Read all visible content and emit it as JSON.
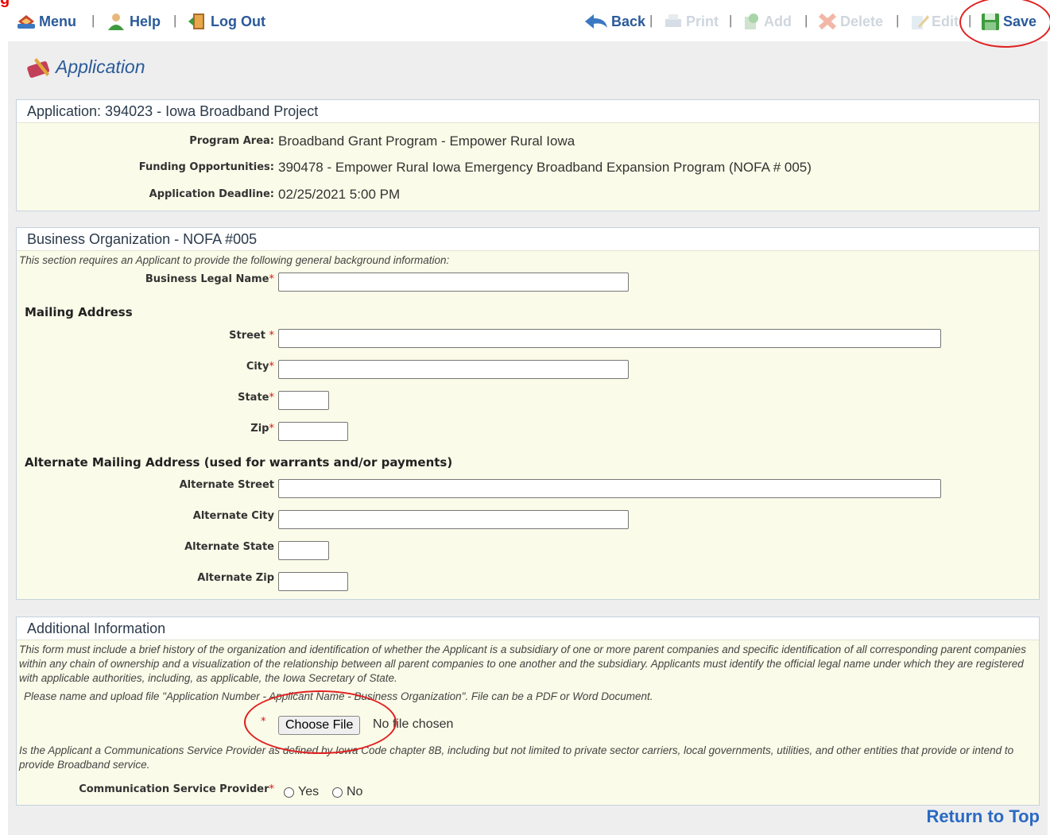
{
  "banner_text": "g",
  "toolbar": {
    "menu": "Menu",
    "help": "Help",
    "logout": "Log Out",
    "back": "Back",
    "print": "Print",
    "add": "Add",
    "delete": "Delete",
    "edit": "Edit",
    "save": "Save",
    "separator": "|"
  },
  "page": {
    "title": "Application"
  },
  "app_panel": {
    "header": "Application: 394023 - Iowa Broadband Project",
    "fields": [
      {
        "label": "Program Area:",
        "value": "Broadband Grant Program - Empower Rural Iowa"
      },
      {
        "label": "Funding Opportunities:",
        "value": "390478 - Empower Rural Iowa Emergency Broadband Expansion Program (NOFA # 005)"
      },
      {
        "label": "Application Deadline:",
        "value": "02/25/2021 5:00 PM"
      }
    ]
  },
  "business_panel": {
    "header": "Business Organization - NOFA #005",
    "intro": "This section requires an Applicant to provide the following general background information:",
    "legal_name_label": "Business Legal Name",
    "mailing_heading": "Mailing Address",
    "street_label": "Street ",
    "city_label": "City",
    "state_label": "State",
    "zip_label": "Zip",
    "alt_heading": "Alternate Mailing Address (used for warrants and/or payments)",
    "alt_street_label": "Alternate Street",
    "alt_city_label": "Alternate City",
    "alt_state_label": "Alternate State",
    "alt_zip_label": "Alternate Zip",
    "required_mark": "*"
  },
  "additional_panel": {
    "header": "Additional Information",
    "description": "This form must include a brief history of the organization and identification of whether the Applicant is a subsidiary of one or more parent companies and specific identification of all corresponding parent companies within any chain of ownership and a visualization of the relationship between all parent companies to one another and the subsidiary. Applicants must identify the official legal name under which they are registered with applicable authorities, including, as applicable, the Iowa Secretary of State.",
    "upload_instruction": "Please name and upload file \"Application Number - Applicant Name - Business Organization\". File can be a PDF or Word Document.",
    "choose_file": "Choose File",
    "no_file": "No file chosen",
    "csp_question": "Is the Applicant a Communications Service Provider as defined by Iowa Code chapter 8B, including but not limited to private sector carriers, local governments, utilities, and other entities that provide or intend to provide Broadband service.",
    "csp_label": "Communication Service Provider",
    "yes": "Yes",
    "no": "No",
    "required_mark": "*"
  },
  "footer": {
    "return_to_top": "Return to Top"
  },
  "colors": {
    "link": "#2a5a9a",
    "panel_bg": "#fbfbe9",
    "annotation": "#e02020"
  }
}
